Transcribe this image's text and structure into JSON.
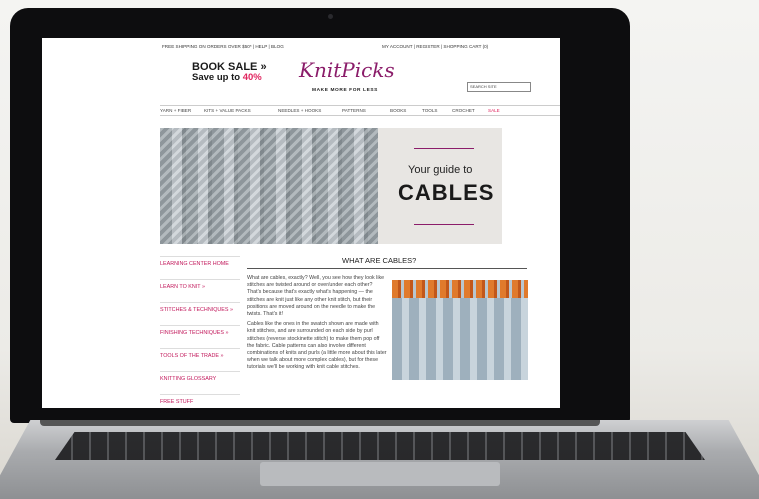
{
  "topbar": {
    "shipping": "FREE SHIPPING ON ORDERS OVER $50* | HELP | BLOG",
    "account": "MY ACCOUNT | REGISTER | SHOPPING CART (0)"
  },
  "banner": {
    "line1": "BOOK SALE »",
    "line2_prefix": "Save up to ",
    "line2_pct": "40%"
  },
  "logo": {
    "text": "KnitPicks",
    "tagline": "MAKE MORE FOR LESS"
  },
  "search": {
    "placeholder": "SEARCH SITE"
  },
  "nav": [
    "YARN + FIBER",
    "KITS + VALUE PACKS",
    "NEEDLES + HOOKS",
    "PATTERNS",
    "BOOKS",
    "TOOLS",
    "CROCHET",
    "SALE"
  ],
  "hero": {
    "line1": "Your guide to",
    "line2": "CABLES"
  },
  "sidebar": [
    "LEARNING CENTER HOME",
    "LEARN TO KNIT »",
    "STITCHES & TECHNIQUES »",
    "FINISHING TECHNIQUES »",
    "TOOLS OF THE TRADE »",
    "KNITTING GLOSSARY",
    "FREE STUFF"
  ],
  "article": {
    "title": "WHAT ARE CABLES?",
    "p1": "What are cables, exactly? Well, you see how they look like stitches are twisted around or over/under each other? That's because that's exactly what's happening — the stitches are knit just like any other knit stitch, but their positions are moved around on the needle to make the twists. That's it!",
    "p2": "Cables like the ones in the swatch shown are made with knit stitches, and are surrounded on each side by purl stitches (reverse stockinette stitch) to make them pop off the fabric. Cable patterns can also involve different combinations of knits and purls (a little more about this later when we talk about more complex cables), but for these tutorials we'll be working with knit cable stitches."
  }
}
